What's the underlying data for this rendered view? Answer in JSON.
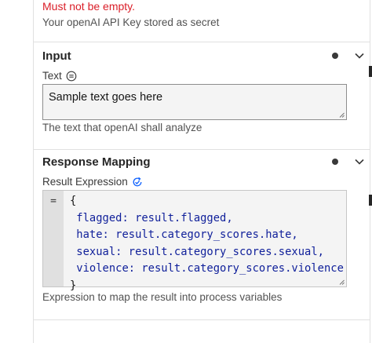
{
  "secret": {
    "error": "Must not be empty.",
    "helper": "Your openAI API Key stored as secret"
  },
  "input_section": {
    "title": "Input",
    "text_label": "Text",
    "text_value": "Sample text goes here",
    "helper": "The text that openAI shall analyze"
  },
  "response_section": {
    "title": "Response Mapping",
    "expr_label": "Result Expression",
    "gutter_symbol": "=",
    "code_lines": [
      "{",
      " flagged: result.flagged,",
      " hate: result.category_scores.hate,",
      " sexual: result.category_scores.sexual,",
      " violence: result.category_scores.violence",
      "}"
    ],
    "helper": "Expression to map the result into process variables"
  }
}
